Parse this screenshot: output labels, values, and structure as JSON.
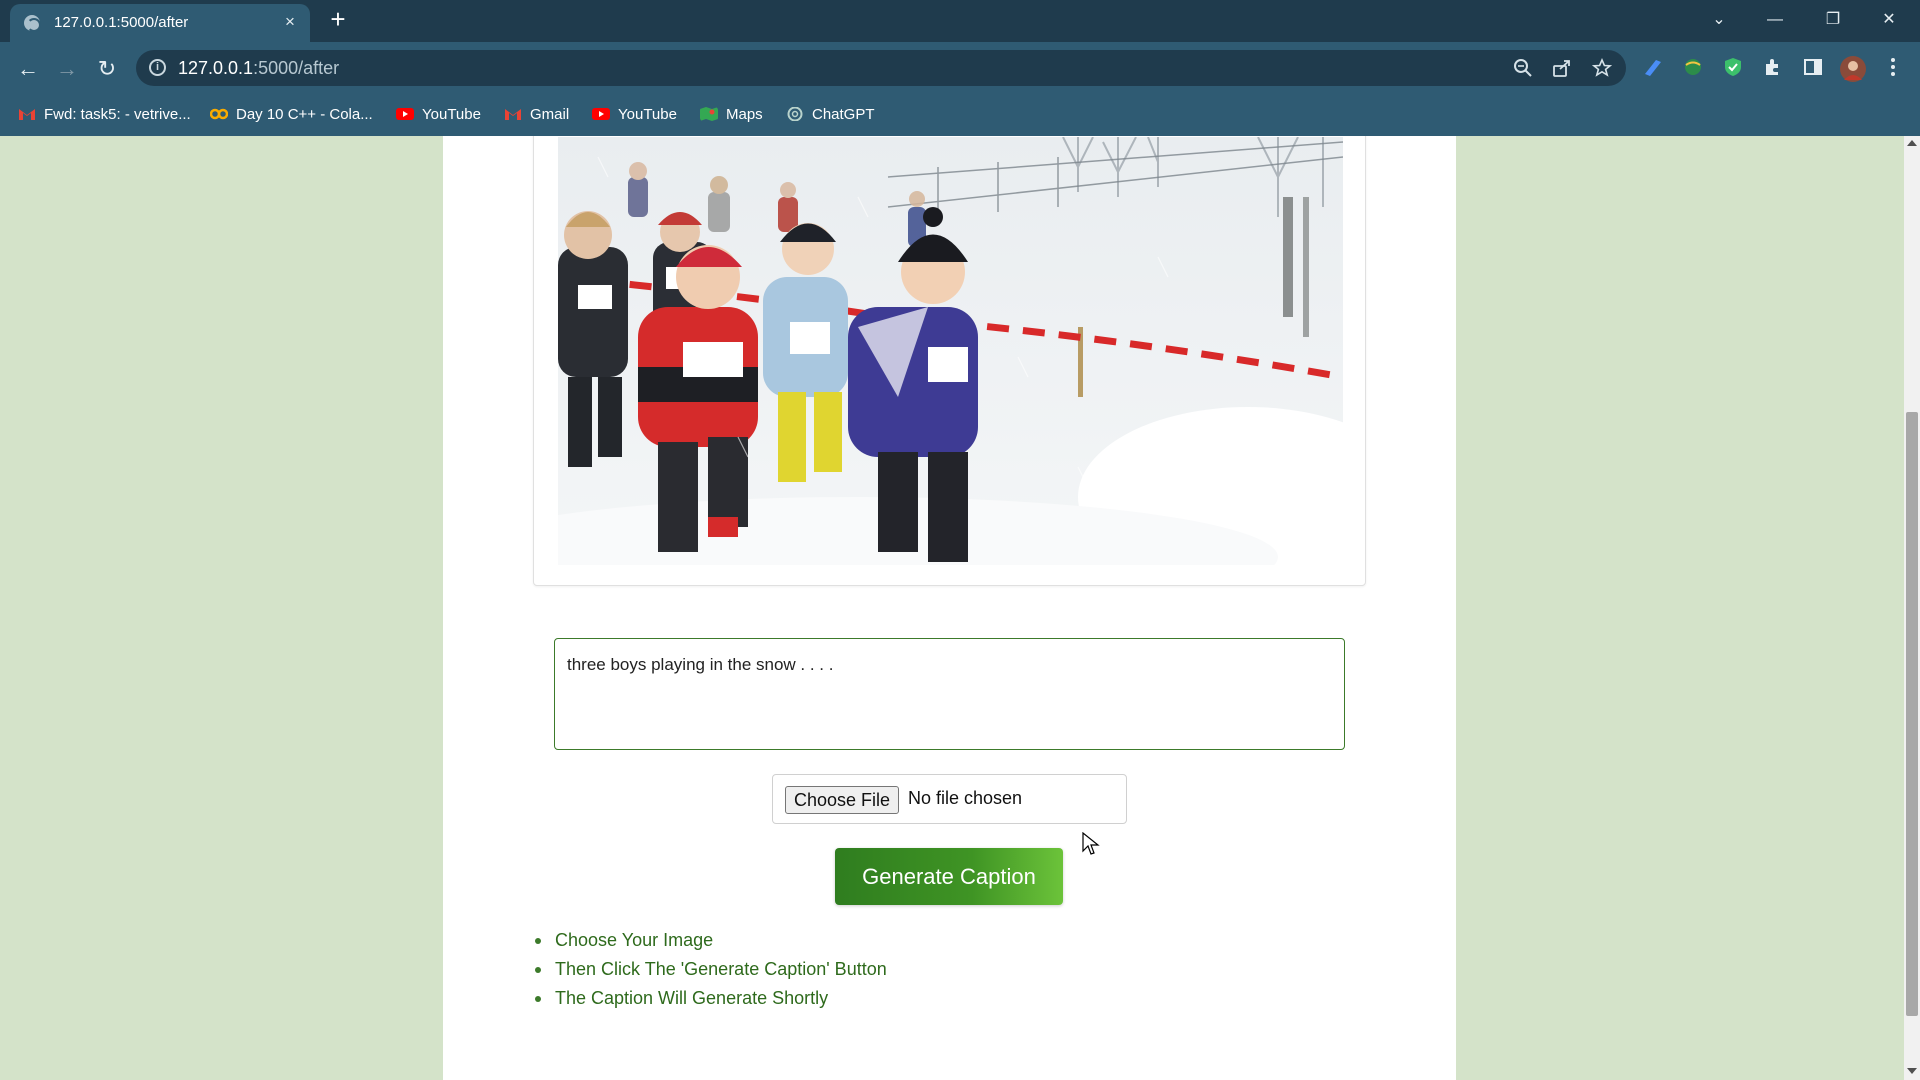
{
  "browser": {
    "tab_title": "127.0.0.1:5000/after",
    "tab_close": "×",
    "new_tab": "+",
    "url_host": "127.0.0.1",
    "url_rest": ":5000/after",
    "info_glyph": "i",
    "win": {
      "dropdown": "⌄",
      "minimize": "—",
      "restore": "❐",
      "close": "✕"
    },
    "nav": {
      "back": "←",
      "forward": "→",
      "reload": "↻"
    },
    "omni_icons": [
      "zoom-icon",
      "share-icon",
      "bookmark-star-icon"
    ],
    "extensions": [
      "pen-extension-icon",
      "globe-extension-icon",
      "shield-extension-icon",
      "puzzle-extensions-icon",
      "side-panel-icon",
      "profile-avatar-icon",
      "kebab-menu-icon"
    ]
  },
  "bookmarks": [
    {
      "label": "Fwd: task5: - vetrive...",
      "icon": "gmail-icon",
      "color": "#ea4335"
    },
    {
      "label": "Day 10 C++ - Cola...",
      "icon": "colab-icon",
      "color": "#f9ab00"
    },
    {
      "label": "YouTube",
      "icon": "youtube-icon",
      "color": "#ff0000"
    },
    {
      "label": "Gmail",
      "icon": "gmail-icon",
      "color": "#ea4335"
    },
    {
      "label": "YouTube",
      "icon": "youtube-icon",
      "color": "#ff0000"
    },
    {
      "label": "Maps",
      "icon": "maps-icon",
      "color": "#34a853"
    },
    {
      "label": "ChatGPT",
      "icon": "chatgpt-icon",
      "color": "#74aa9c"
    }
  ],
  "main": {
    "photo_alt": "uploaded-photo",
    "caption": "three boys playing in the snow . . . .",
    "file_button": "Choose File",
    "file_status": "No file chosen",
    "generate_button": "Generate Caption",
    "steps": [
      "Choose Your Image",
      "Then Click The 'Generate Caption' Button",
      "The Caption Will Generate Shortly"
    ]
  },
  "colors": {
    "page_bg": "#d4e3c9",
    "accent_green": "#3c7a2a",
    "chrome_dark": "#1f3b4d",
    "chrome_mid": "#2f5b73"
  }
}
